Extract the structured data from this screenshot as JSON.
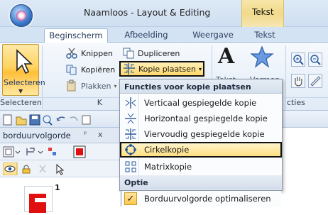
{
  "window": {
    "title": "Naamloos - Layout & Editing",
    "context_tab": "Tekst"
  },
  "tabs": [
    {
      "label": "Beginscherm",
      "active": true
    },
    {
      "label": "Afbeelding",
      "active": false
    },
    {
      "label": "Weergave",
      "active": false
    },
    {
      "label": "Tekst",
      "active": false
    }
  ],
  "ribbon": {
    "select_label": "Selecteren",
    "knippen": "Knippen",
    "kopieren": "Kopiëren",
    "plakken": "Plakken",
    "dupliceren": "Dupliceren",
    "kopie_plaatsen": "Kopie plaatsen",
    "tekst": "Tekst",
    "vormen": "Vormen",
    "groups": {
      "select": "Selecteren",
      "k": "K",
      "functies_partial": "cties"
    }
  },
  "panel": {
    "title": "borduurvolgorde",
    "pin": "ᵖ",
    "close": "x",
    "thumb_number": "1"
  },
  "menu": {
    "header": "Functies voor kopie plaatsen",
    "items": [
      {
        "label": "Verticaal gespiegelde kopie",
        "icon": "vertical-mirror-icon"
      },
      {
        "label": "Horizontaal gespiegelde kopie",
        "icon": "horizontal-mirror-icon"
      },
      {
        "label": "Viervoudig gespiegelde kopie",
        "icon": "fourfold-mirror-icon"
      },
      {
        "label": "Cirkelkopie",
        "icon": "circle-copy-icon",
        "highlighted": true
      },
      {
        "label": "Matrixkopie",
        "icon": "matrix-copy-icon"
      }
    ],
    "section_optie": "Optie",
    "optimize": {
      "label": "Borduurvolgorde optimaliseren",
      "checked": true
    }
  },
  "colors": {
    "accent": "#ffd35f",
    "ribbon_blue": "#dbe6f3",
    "thumb_red": "#e01010"
  }
}
